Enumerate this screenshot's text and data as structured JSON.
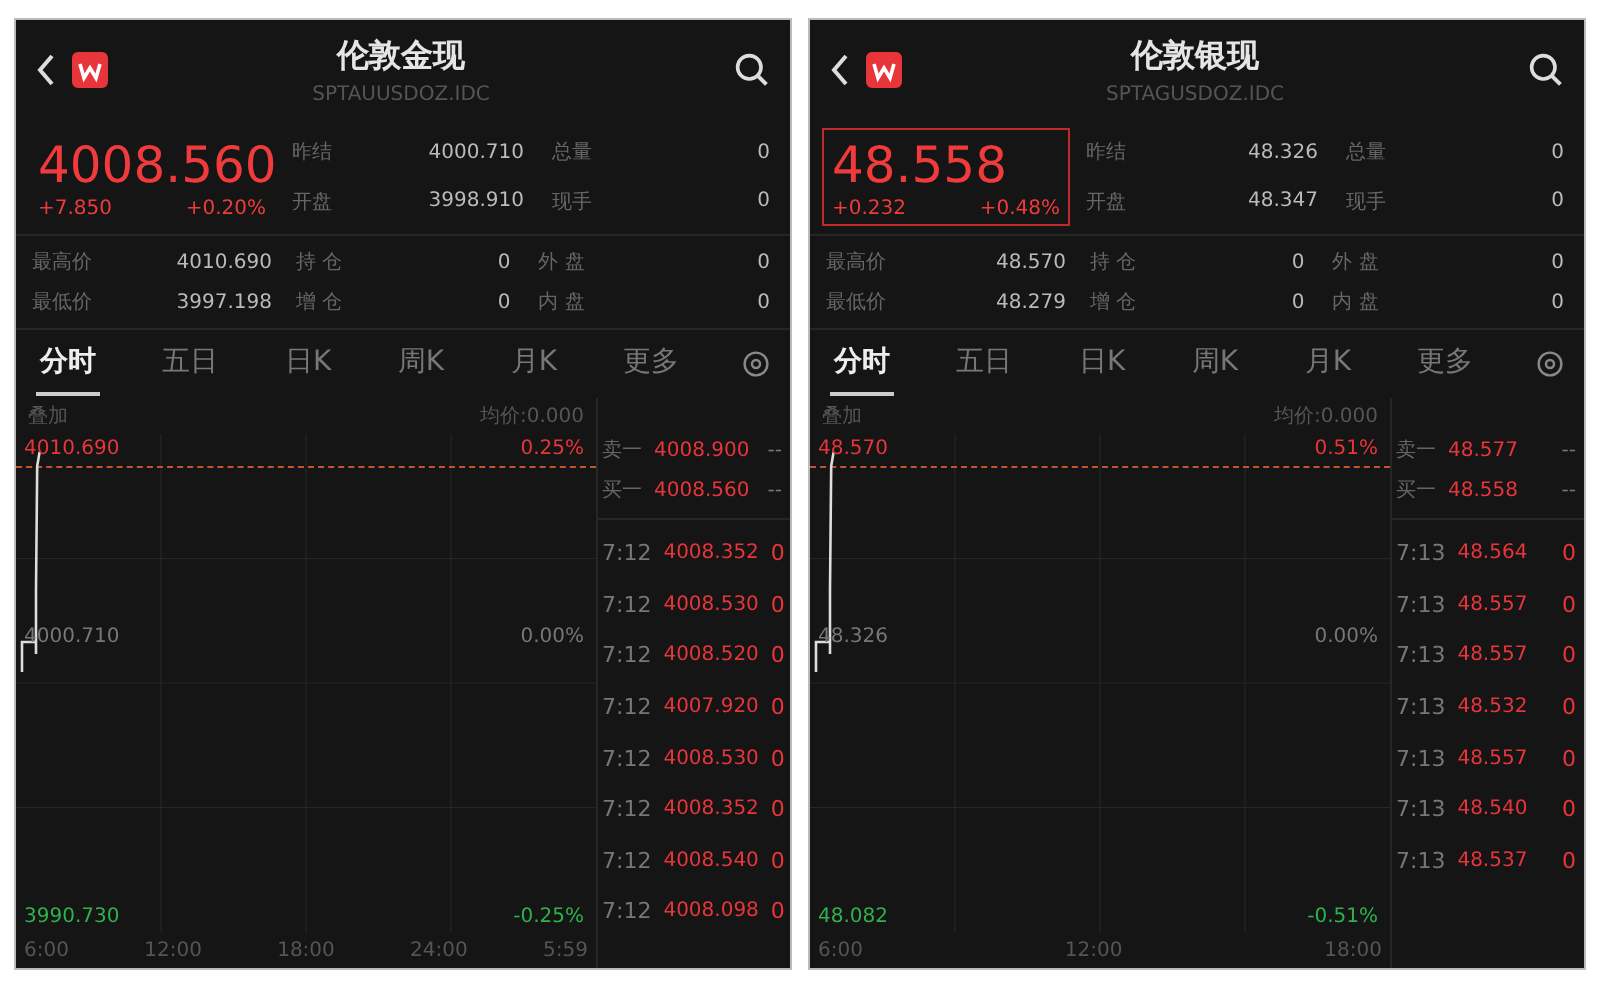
{
  "panels": [
    {
      "title": "伦敦金现",
      "code": "SPTAUUSDOZ.IDC",
      "price": "4008.560",
      "change": "+7.850",
      "change_pct": "+0.20%",
      "highlighted": false,
      "stats": [
        {
          "label": "昨结",
          "value": "4000.710",
          "label2": "总量",
          "value2": "0"
        },
        {
          "label": "开盘",
          "value": "3998.910",
          "label2": "现手",
          "value2": "0"
        }
      ],
      "details": [
        {
          "label": "最高价",
          "value": "4010.690",
          "label2": "持 仓",
          "value2": "0",
          "label3": "外 盘",
          "value3": "0"
        },
        {
          "label": "最低价",
          "value": "3997.198",
          "label2": "增 仓",
          "value2": "0",
          "label3": "内 盘",
          "value3": "0"
        }
      ],
      "tabs": [
        {
          "label": "分时",
          "selected": true
        },
        {
          "label": "五日",
          "selected": false
        },
        {
          "label": "日K",
          "selected": false
        },
        {
          "label": "周K",
          "selected": false
        },
        {
          "label": "月K",
          "selected": false
        },
        {
          "label": "更多",
          "selected": false
        }
      ],
      "overlay_label": "叠加",
      "avg_price": "均价:0.000",
      "chart_labels": {
        "top_price": "4010.690",
        "top_pct": "0.25%",
        "mid_price": "4000.710",
        "mid_pct": "0.00%",
        "low_price": "3990.730",
        "low_pct": "-0.25%"
      },
      "time_axis": [
        "6:00",
        "12:00",
        "18:00",
        "24:00",
        "5:59"
      ],
      "quotes": [
        {
          "label": "卖一",
          "price": "4008.900",
          "volume": "--"
        },
        {
          "label": "买一",
          "price": "4008.560",
          "volume": "--"
        }
      ],
      "trades": [
        {
          "time": "7:12",
          "price": "4008.352",
          "volume": "0"
        },
        {
          "time": "7:12",
          "price": "4008.530",
          "volume": "0"
        },
        {
          "time": "7:12",
          "price": "4008.520",
          "volume": "0"
        },
        {
          "time": "7:12",
          "price": "4007.920",
          "volume": "0"
        },
        {
          "time": "7:12",
          "price": "4008.530",
          "volume": "0"
        },
        {
          "time": "7:12",
          "price": "4008.352",
          "volume": "0"
        },
        {
          "time": "7:12",
          "price": "4008.540",
          "volume": "0"
        },
        {
          "time": "7:12",
          "price": "4008.098",
          "volume": "0"
        }
      ]
    },
    {
      "title": "伦敦银现",
      "code": "SPTAGUSDOZ.IDC",
      "price": "48.558",
      "change": "+0.232",
      "change_pct": "+0.48%",
      "highlighted": true,
      "stats": [
        {
          "label": "昨结",
          "value": "48.326",
          "label2": "总量",
          "value2": "0"
        },
        {
          "label": "开盘",
          "value": "48.347",
          "label2": "现手",
          "value2": "0"
        }
      ],
      "details": [
        {
          "label": "最高价",
          "value": "48.570",
          "label2": "持 仓",
          "value2": "0",
          "label3": "外 盘",
          "value3": "0"
        },
        {
          "label": "最低价",
          "value": "48.279",
          "label2": "增 仓",
          "value2": "0",
          "label3": "内 盘",
          "value3": "0"
        }
      ],
      "tabs": [
        {
          "label": "分时",
          "selected": true
        },
        {
          "label": "五日",
          "selected": false
        },
        {
          "label": "日K",
          "selected": false
        },
        {
          "label": "周K",
          "selected": false
        },
        {
          "label": "月K",
          "selected": false
        },
        {
          "label": "更多",
          "selected": false
        }
      ],
      "overlay_label": "叠加",
      "avg_price": "均价:0.000",
      "chart_labels": {
        "top_price": "48.570",
        "top_pct": "0.51%",
        "mid_price": "48.326",
        "mid_pct": "0.00%",
        "low_price": "48.082",
        "low_pct": "-0.51%"
      },
      "time_axis": [
        "6:00",
        "12:00",
        "18:00"
      ],
      "quotes": [
        {
          "label": "卖一",
          "price": "48.577",
          "volume": "--"
        },
        {
          "label": "买一",
          "price": "48.558",
          "volume": "--"
        }
      ],
      "trades": [
        {
          "time": "7:13",
          "price": "48.564",
          "volume": "0"
        },
        {
          "time": "7:13",
          "price": "48.557",
          "volume": "0"
        },
        {
          "time": "7:13",
          "price": "48.557",
          "volume": "0"
        },
        {
          "time": "7:13",
          "price": "48.532",
          "volume": "0"
        },
        {
          "time": "7:13",
          "price": "48.557",
          "volume": "0"
        },
        {
          "time": "7:13",
          "price": "48.540",
          "volume": "0"
        },
        {
          "time": "7:13",
          "price": "48.537",
          "volume": "0"
        }
      ]
    }
  ]
}
